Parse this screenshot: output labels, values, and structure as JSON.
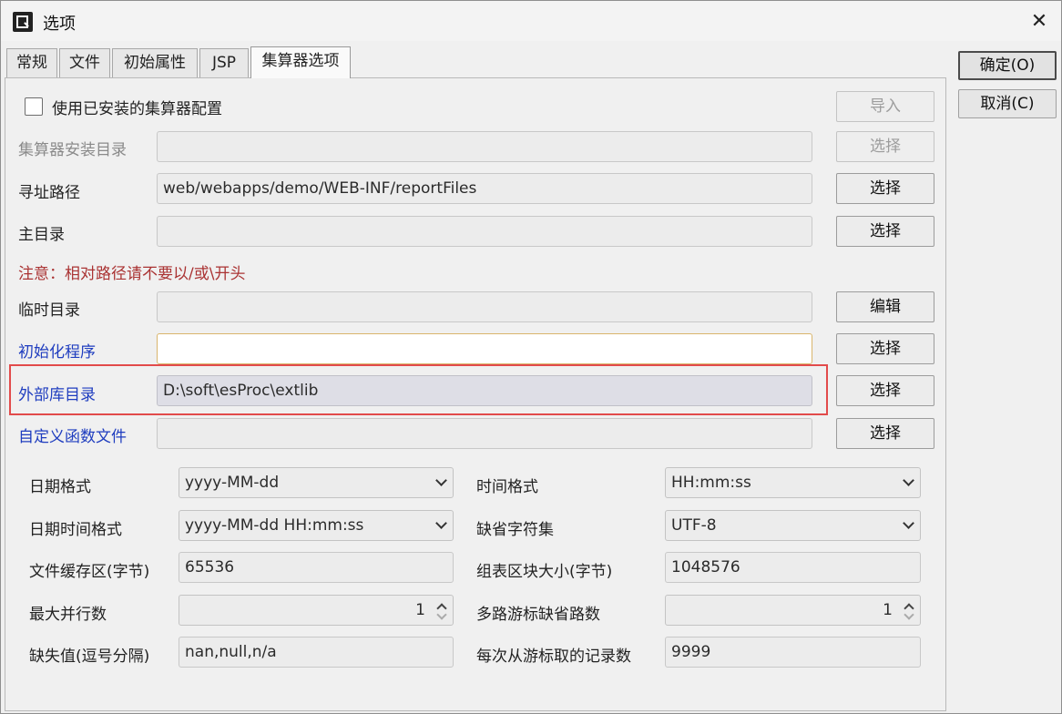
{
  "window": {
    "title": "选项",
    "close_glyph": "✕"
  },
  "tabs": [
    {
      "label": "常规"
    },
    {
      "label": "文件"
    },
    {
      "label": "初始属性"
    },
    {
      "label": "JSP"
    },
    {
      "label": "集算器选项",
      "active": true
    }
  ],
  "side_buttons": {
    "ok": "确定(O)",
    "cancel": "取消(C)"
  },
  "use_installed": {
    "label": "使用已安装的集算器配置",
    "checked": false,
    "import_button": "导入"
  },
  "rows": {
    "install_dir": {
      "label": "集算器安装目录",
      "value": "",
      "button": "选择"
    },
    "search_path": {
      "label": "寻址路径",
      "value": "web/webapps/demo/WEB-INF/reportFiles",
      "button": "选择"
    },
    "main_dir": {
      "label": "主目录",
      "value": "",
      "button": "选择"
    },
    "note": "注意：相对路径请不要以/或\\开头",
    "temp_dir": {
      "label": "临时目录",
      "value": "",
      "button": "编辑"
    },
    "init_program": {
      "label": "初始化程序",
      "value": "",
      "button": "选择"
    },
    "ext_lib_dir": {
      "label": "外部库目录",
      "value": "D:\\soft\\esProc\\extlib",
      "button": "选择"
    },
    "custom_func_file": {
      "label": "自定义函数文件",
      "value": "",
      "button": "选择"
    }
  },
  "settings": {
    "date_format": {
      "label": "日期格式",
      "value": "yyyy-MM-dd"
    },
    "time_format": {
      "label": "时间格式",
      "value": "HH:mm:ss"
    },
    "datetime_format": {
      "label": "日期时间格式",
      "value": "yyyy-MM-dd HH:mm:ss"
    },
    "default_charset": {
      "label": "缺省字符集",
      "value": "UTF-8"
    },
    "file_buffer": {
      "label": "文件缓存区(字节)",
      "value": "65536"
    },
    "block_size": {
      "label": "组表区块大小(字节)",
      "value": "1048576"
    },
    "max_parallel": {
      "label": "最大并行数",
      "value": "1"
    },
    "cursor_paths": {
      "label": "多路游标缺省路数",
      "value": "1"
    },
    "missing_values": {
      "label": "缺失值(逗号分隔)",
      "value": "nan,null,n/a"
    },
    "fetch_count": {
      "label": "每次从游标取的记录数",
      "value": "9999"
    }
  },
  "colors": {
    "highlight_border": "#e24b4b",
    "blue_label": "#1f3dbf",
    "note_red": "#a33333"
  }
}
